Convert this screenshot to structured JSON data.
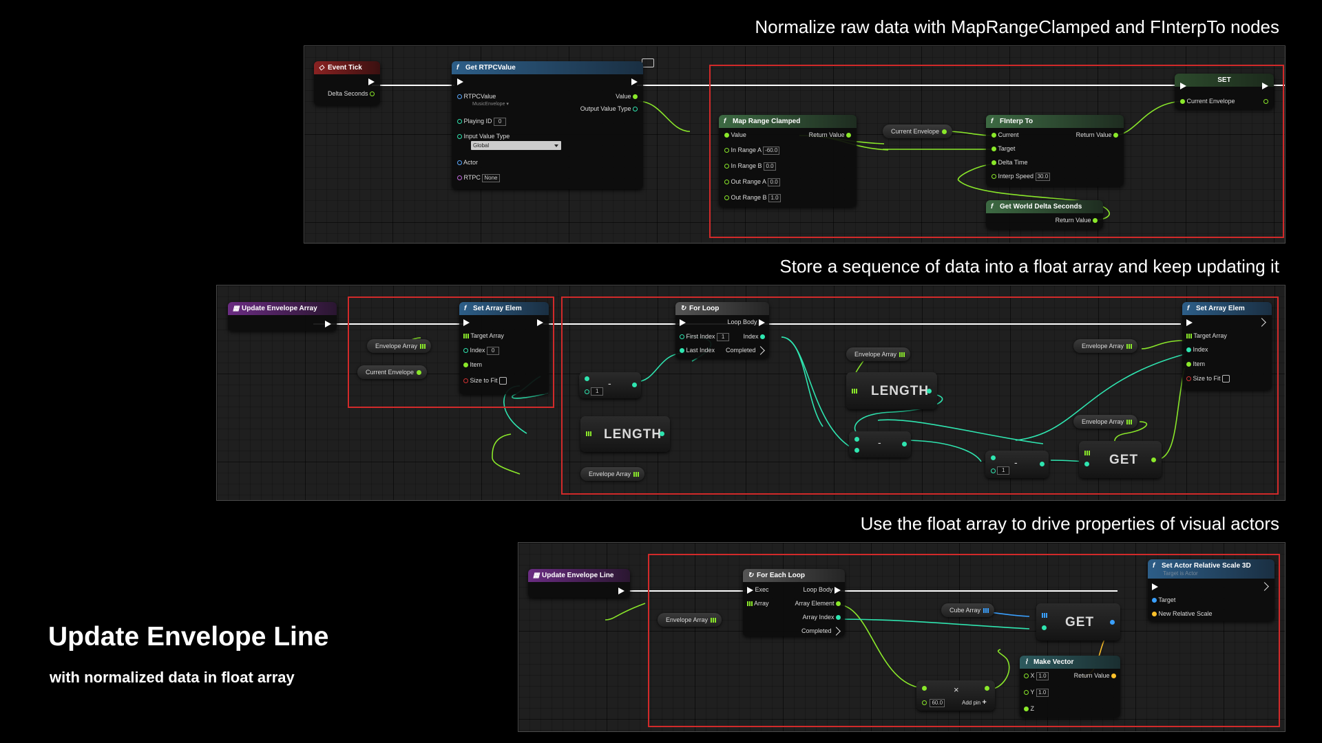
{
  "headings": {
    "top": "Normalize raw data with MapRangeClamped and FInterpTo nodes",
    "middle": "Store a sequence of data into a float array and keep updating it",
    "bottom": "Use the float array to drive properties of visual actors"
  },
  "title": "Update Envelope Line",
  "subtitle": "with normalized data in float array",
  "colors": {
    "float_pin": "#8ae82a",
    "int_pin": "#2fe5b0",
    "object_pin": "#5aa8ff",
    "vector_pin": "#ffc12a",
    "selection": "#d22a2a"
  },
  "panel1": {
    "event_tick": {
      "title": "Event Tick",
      "delta": "Delta Seconds"
    },
    "get_rtpc": {
      "title": "Get RTPCValue",
      "rtpc_value": "RTPCValue",
      "rtpc_value_asset": "MusicEnvelope",
      "value": "Value",
      "output_value_type": "Output Value Type",
      "playing_id": "Playing ID",
      "playing_id_val": "0",
      "input_value_type": "Input Value Type",
      "input_value_type_val": "Global",
      "actor": "Actor",
      "rtpc": "RTPC",
      "rtpc_val": "None"
    },
    "map_range": {
      "title": "Map Range Clamped",
      "value": "Value",
      "return_value": "Return Value",
      "in_a": "In Range A",
      "in_a_val": "-60.0",
      "in_b": "In Range B",
      "in_b_val": "0.0",
      "out_a": "Out Range A",
      "out_a_val": "0.0",
      "out_b": "Out Range B",
      "out_b_val": "1.0"
    },
    "current_envelope_pill": "Current Envelope",
    "finterp": {
      "title": "FInterp To",
      "current": "Current",
      "return_value": "Return Value",
      "target": "Target",
      "delta_time": "Delta Time",
      "interp_speed": "Interp Speed",
      "interp_speed_val": "30.0"
    },
    "world_delta": {
      "title": "Get World Delta Seconds",
      "return_value": "Return Value"
    },
    "set": {
      "title": "SET",
      "current_envelope": "Current Envelope"
    }
  },
  "panel2": {
    "update_array": {
      "title": "Update Envelope Array"
    },
    "envelope_array_pill": "Envelope Array",
    "current_envelope_pill": "Current Envelope",
    "set_elem": {
      "title": "Set Array Elem",
      "target_array": "Target Array",
      "index": "Index",
      "index_val": "0",
      "item": "Item",
      "size_to_fit": "Size to Fit"
    },
    "minus_a": {
      "symbol": "-",
      "val": "1"
    },
    "length_label": "LENGTH",
    "for_loop": {
      "title": "For Loop",
      "loop_body": "Loop Body",
      "first_index": "First Index",
      "first_index_val": "1",
      "index": "Index",
      "last_index": "Last Index",
      "completed": "Completed"
    },
    "minus_b": {
      "symbol": "-"
    },
    "minus_c": {
      "symbol": "-",
      "val": "1"
    },
    "get_label": "GET",
    "set_elem2": {
      "title": "Set Array Elem",
      "target_array": "Target Array",
      "index": "Index",
      "item": "Item",
      "size_to_fit": "Size to Fit"
    }
  },
  "panel3": {
    "update_line": {
      "title": "Update Envelope Line"
    },
    "envelope_array_pill": "Envelope Array",
    "for_each": {
      "title": "For Each Loop",
      "exec": "Exec",
      "loop_body": "Loop Body",
      "array": "Array",
      "array_element": "Array Element",
      "array_index": "Array Index",
      "completed": "Completed"
    },
    "cube_array_pill": "Cube Array",
    "get_label": "GET",
    "set_scale": {
      "title": "Set Actor Relative Scale 3D",
      "subtitle": "Target is Actor",
      "target": "Target",
      "new_scale": "New Relative Scale"
    },
    "make_vector": {
      "title": "Make Vector",
      "x": "X",
      "x_val": "1.0",
      "y": "Y",
      "y_val": "1.0",
      "z": "Z",
      "return_value": "Return Value"
    },
    "multiply": {
      "symbol": "×",
      "val": "60.0",
      "add_pin": "Add pin",
      "add_symbol": "+"
    }
  }
}
